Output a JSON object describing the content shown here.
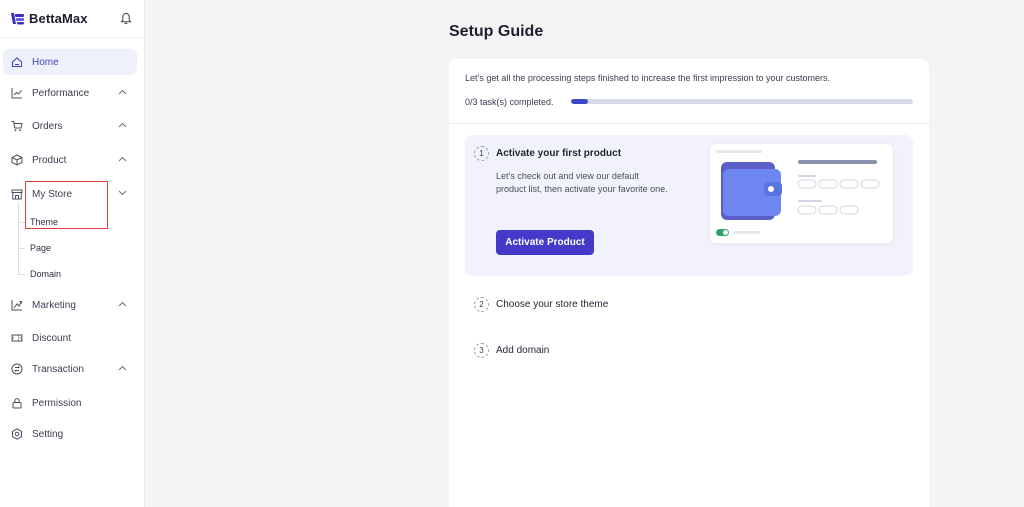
{
  "brand": {
    "name": "BettaMax"
  },
  "sidebar": {
    "items": [
      {
        "label": "Home",
        "icon": "home-icon",
        "active": true
      },
      {
        "label": "Performance",
        "icon": "chart-icon",
        "chevron": "up"
      },
      {
        "label": "Orders",
        "icon": "cart-icon",
        "chevron": "up"
      },
      {
        "label": "Product",
        "icon": "box-icon",
        "chevron": "up"
      },
      {
        "label": "My Store",
        "icon": "store-icon",
        "chevron": "down"
      },
      {
        "label": "Marketing",
        "icon": "megaphone-icon",
        "chevron": "up"
      },
      {
        "label": "Discount",
        "icon": "ticket-icon"
      },
      {
        "label": "Transaction",
        "icon": "transaction-icon",
        "chevron": "up"
      },
      {
        "label": "Permission",
        "icon": "lock-icon"
      },
      {
        "label": "Setting",
        "icon": "gear-icon"
      }
    ],
    "store_sub": [
      "Theme",
      "Page",
      "Domain"
    ]
  },
  "main": {
    "title": "Setup Guide",
    "intro": "Let’s get all the processing steps finished to increase the first impression to your customers.",
    "progress_label": "0/3 task(s) completed.",
    "progress_fraction": 0.05,
    "steps": [
      {
        "num": "1",
        "title": "Activate your first product",
        "desc": "Let’s check out and view our default product list, then activate your favorite one.",
        "button": "Activate Product"
      },
      {
        "num": "2",
        "title": "Choose your store theme"
      },
      {
        "num": "3",
        "title": "Add domain"
      }
    ]
  },
  "colors": {
    "accent": "#4439c9",
    "progress": "#3e49c9",
    "active_nav_bg": "#eef0fa",
    "highlight_border": "#d9423a"
  }
}
